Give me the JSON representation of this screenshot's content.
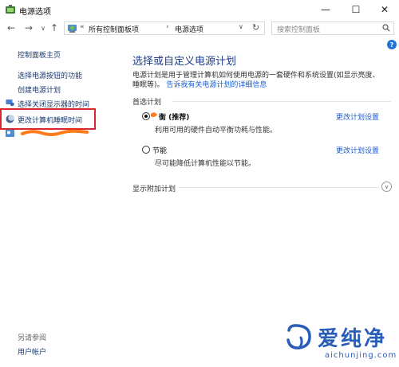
{
  "window": {
    "title": "电源选项"
  },
  "controls": {
    "minimize": "—",
    "maximize": "☐",
    "close": "✕"
  },
  "address": {
    "crumbs": [
      "所有控制面板项",
      "电源选项"
    ],
    "prefix": "«",
    "separator": "›"
  },
  "search": {
    "placeholder": "搜索控制面板"
  },
  "help": {
    "label": "?"
  },
  "sidebar": {
    "items": [
      {
        "label": "控制面板主页"
      },
      {
        "label": "选择电源按钮的功能"
      },
      {
        "label": "创建电源计划"
      },
      {
        "label": "选择关闭显示器的时间"
      },
      {
        "label": "更改计算机睡眠时间"
      }
    ],
    "see_also": "另请参阅",
    "user_accounts": "用户帐户"
  },
  "main": {
    "title": "选择或自定义电源计划",
    "desc_line1": "电源计划是用于管理计算机如何使用电源的一套硬件和系统设置(如显示亮度、",
    "desc_line2_prefix": "睡眠等)。",
    "desc_link": "告诉我有关电源计划的详细信息",
    "preferred_plans": "首选计划",
    "plans": [
      {
        "name": "平衡 (推荐)",
        "visible_name": "衡 (推荐)",
        "description": "利用可用的硬件自动平衡功耗与性能。",
        "link": "更改计划设置",
        "selected": true
      },
      {
        "name": "节能",
        "description": "尽可能降低计算机性能以节能。",
        "link": "更改计划设置",
        "selected": false
      }
    ],
    "show_additional": "显示附加计划"
  },
  "watermark": {
    "text": "爱纯净",
    "url": "aichunjing.com"
  },
  "colors": {
    "accent": "#1e3c8c",
    "link": "#1a5dd6",
    "highlight_box": "#d9262c",
    "scribble": "#ff7a1a"
  }
}
